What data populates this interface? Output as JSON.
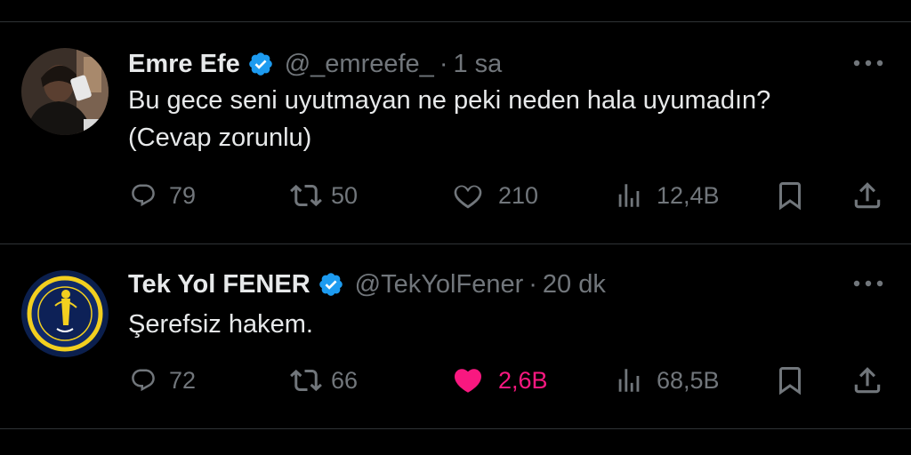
{
  "colors": {
    "background": "#000000",
    "text": "#e7e9ea",
    "muted": "#71767b",
    "divider": "#2f3336",
    "verified": "#1d9bf0",
    "like_active": "#f91880"
  },
  "tweets": [
    {
      "display_name": "Emre Efe",
      "handle": "@_emreefe_",
      "separator": "·",
      "time": "1 sa",
      "text": "Bu gece seni uyutmayan ne peki neden hala uyumadın?\n(Cevap zorunlu)",
      "replies": "79",
      "retweets": "50",
      "likes": "210",
      "views": "12,4B",
      "liked": false,
      "icons": [
        "reply-icon",
        "retweet-icon",
        "like-icon",
        "views-icon",
        "bookmark-icon",
        "share-icon",
        "more-icon",
        "verified-badge-icon"
      ]
    },
    {
      "display_name": "Tek Yol FENER",
      "handle": "@TekYolFener",
      "separator": "·",
      "time": "20 dk",
      "text": "Şerefsiz hakem.",
      "replies": "72",
      "retweets": "66",
      "likes": "2,6B",
      "views": "68,5B",
      "liked": true,
      "icons": [
        "reply-icon",
        "retweet-icon",
        "like-icon",
        "views-icon",
        "bookmark-icon",
        "share-icon",
        "more-icon",
        "verified-badge-icon"
      ]
    }
  ]
}
